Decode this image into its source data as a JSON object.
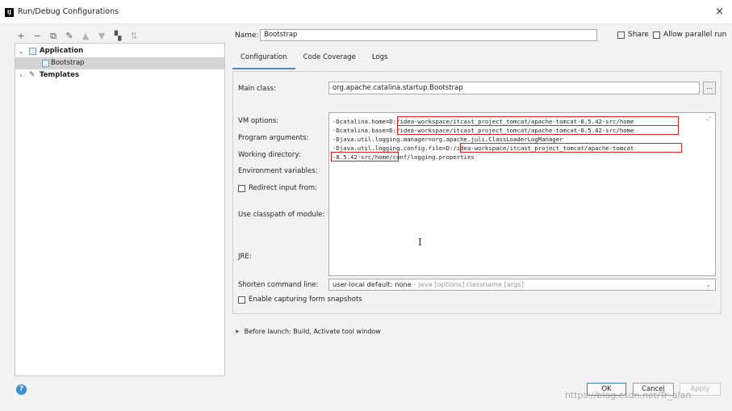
{
  "window": {
    "title": "Run/Debug Configurations",
    "icon_text": "IJ",
    "close": "×"
  },
  "left_toolbar": [
    {
      "icon": "plus-icon",
      "glyph": "+"
    },
    {
      "icon": "minus-icon",
      "glyph": "−"
    },
    {
      "icon": "copy-icon",
      "glyph": "⧉"
    },
    {
      "icon": "wrench-icon",
      "glyph": "✎"
    },
    {
      "icon": "arrow-up-icon",
      "glyph": "▲"
    },
    {
      "icon": "arrow-down-icon",
      "glyph": "▼"
    },
    {
      "icon": "folder-icon",
      "glyph": "▚"
    },
    {
      "icon": "sort-icon",
      "glyph": "⇅"
    }
  ],
  "tree": {
    "application": "Application",
    "bootstrap": "Bootstrap",
    "templates": "Templates"
  },
  "name": {
    "label": "Name:",
    "value": "Bootstrap"
  },
  "share": {
    "label": "Share"
  },
  "allow_parallel": {
    "label": "Allow parallel run"
  },
  "tabs": [
    "Configuration",
    "Code Coverage",
    "Logs"
  ],
  "form": {
    "main_class_label": "Main class:",
    "main_class_value": "org.apache.catalina.startup.Bootstrap",
    "browse": "...",
    "vm_options_label": "VM options:",
    "program_arguments_label": "Program arguments:",
    "working_directory_label": "Working directory:",
    "env_vars_label": "Environment variables:",
    "redirect_label": "Redirect input from:",
    "classpath_label": "Use classpath of module:",
    "jre_label": "JRE:",
    "shorten_label": "Shorten command line:",
    "shorten_value": "user-local default: none",
    "shorten_hint": " - java [options] classname [args]",
    "snapshots_label": "Enable capturing form snapshots"
  },
  "vm_lines": [
    "-Dcatalina.home=D:/idea-workspace/itcast_project_tomcat/apache-tomcat-8.5.42-src/home",
    "-Dcatalina.base=D:/idea-workspace/itcast_project_tomcat/apache-tomcat-8.5.42-src/home",
    "-Djava.util.logging.manager=org.apache.juli.ClassLoaderLogManager",
    "-Djava.util.logging.config.file=D:/idea-workspace/itcast_project_tomcat/apache-tomcat",
    "-8.5.42-src/home/conf/logging.properties"
  ],
  "before_launch": "Before launch: Build, Activate tool window",
  "buttons": {
    "ok": "OK",
    "cancel": "Cancel",
    "apply": "Apply"
  },
  "help": "?",
  "watermark": "https://blog.csdn.net/Tr_alan"
}
